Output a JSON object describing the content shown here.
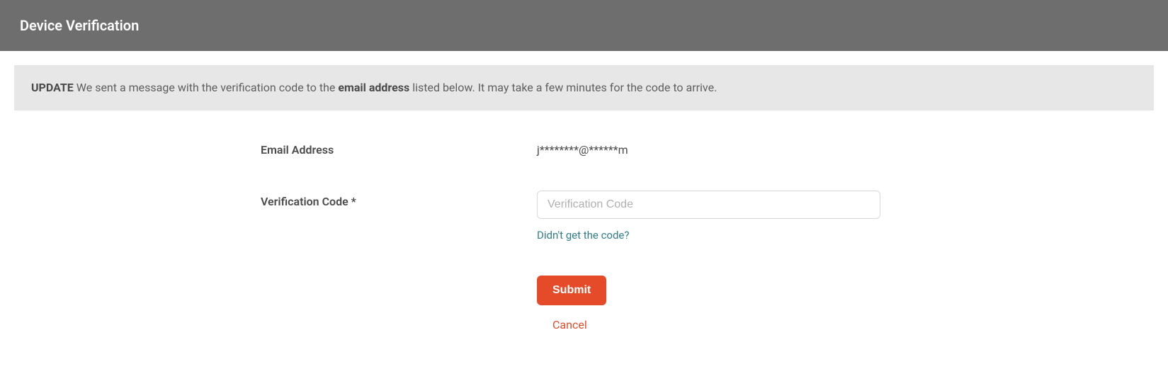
{
  "header": {
    "title": "Device Verification"
  },
  "notice": {
    "prefix_bold": "UPDATE",
    "text_before": " We sent a message with the verification code to the ",
    "mid_bold": "email address",
    "text_after": " listed below. It may take a few minutes for the code to arrive."
  },
  "form": {
    "email_label": "Email Address",
    "email_value": "j********@******m",
    "code_label": "Verification Code *",
    "code_placeholder": "Verification Code",
    "resend_link": "Didn't get the code?",
    "submit_label": "Submit",
    "cancel_label": "Cancel"
  }
}
